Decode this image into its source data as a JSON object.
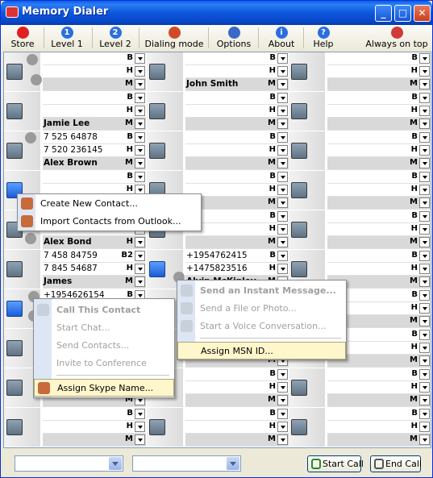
{
  "window": {
    "title": "Memory Dialer",
    "minimize": "_",
    "maximize": "□",
    "close": "✕"
  },
  "toolbar": {
    "items": [
      {
        "label": "Store",
        "icon": "record-icon",
        "color": "#e02020"
      },
      {
        "label": "Level 1",
        "icon": "level-1-icon",
        "color": "#2a6ee0",
        "glyph": "1"
      },
      {
        "label": "Level 2",
        "icon": "level-2-icon",
        "color": "#2a6ee0",
        "glyph": "2"
      },
      {
        "label": "Dialing mode",
        "icon": "phone-icon",
        "color": "#d04a2a"
      },
      {
        "label": "Options",
        "icon": "options-icon",
        "color": "#3a6ac8"
      },
      {
        "label": "About",
        "icon": "info-icon",
        "color": "#2a6ee0",
        "glyph": "i"
      },
      {
        "label": "Help",
        "icon": "help-icon",
        "color": "#2a6ee0",
        "glyph": "?"
      },
      {
        "label": "Always on top",
        "icon": "pin-icon",
        "color": "#d03a3a"
      }
    ]
  },
  "columns": [
    {
      "blocks": [
        {
          "rows": [
            {
              "t": "",
              "k": "B"
            },
            {
              "t": "",
              "k": "H"
            },
            {
              "t": "",
              "k": "M"
            }
          ]
        },
        {
          "rows": [
            {
              "t": "",
              "k": "B"
            },
            {
              "t": "",
              "k": "H"
            },
            {
              "t": "Jamie Lee",
              "k": "M"
            }
          ]
        },
        {
          "rows": [
            {
              "t": "7 525 64878",
              "k": "B"
            },
            {
              "t": "7 520 236145",
              "k": "H"
            },
            {
              "t": "Alex Brown",
              "k": "M"
            }
          ]
        },
        {
          "rows": [
            {
              "t": "",
              "k": "B"
            },
            {
              "t": "",
              "k": "H"
            },
            {
              "t": "",
              "k": "M"
            }
          ]
        },
        {
          "rows": [
            {
              "t": "",
              "k": "B"
            },
            {
              "t": "",
              "k": "H"
            },
            {
              "t": "Alex Bond",
              "k": "H"
            }
          ]
        },
        {
          "rows": [
            {
              "t": "7 458 84759",
              "k": "B2"
            },
            {
              "t": "7 845 54687",
              "k": "H"
            },
            {
              "t": "James",
              "k": "M"
            }
          ]
        },
        {
          "rows": [
            {
              "t": "+1954626154",
              "k": "B"
            },
            {
              "t": "",
              "k": "H"
            },
            {
              "t": "",
              "k": "M"
            }
          ]
        },
        {
          "rows": [
            {
              "t": "",
              "k": "B"
            },
            {
              "t": "",
              "k": "H"
            },
            {
              "t": "",
              "k": "M"
            }
          ]
        },
        {
          "rows": [
            {
              "t": "",
              "k": "B"
            },
            {
              "t": "",
              "k": "H"
            },
            {
              "t": "",
              "k": "M"
            }
          ]
        },
        {
          "rows": [
            {
              "t": "",
              "k": "B"
            },
            {
              "t": "",
              "k": "H"
            },
            {
              "t": "",
              "k": "M"
            }
          ]
        }
      ]
    },
    {
      "blocks": [
        {
          "rows": [
            {
              "t": "",
              "k": "B"
            },
            {
              "t": "",
              "k": "H"
            },
            {
              "t": "John Smith",
              "k": "M"
            }
          ]
        },
        {
          "rows": [
            {
              "t": "",
              "k": "B"
            },
            {
              "t": "",
              "k": "H"
            },
            {
              "t": "",
              "k": "M"
            }
          ]
        },
        {
          "rows": [
            {
              "t": "",
              "k": "B"
            },
            {
              "t": "",
              "k": "H"
            },
            {
              "t": "",
              "k": "M"
            }
          ]
        },
        {
          "rows": [
            {
              "t": "",
              "k": "B"
            },
            {
              "t": "",
              "k": "H"
            },
            {
              "t": "",
              "k": "M"
            }
          ]
        },
        {
          "rows": [
            {
              "t": "",
              "k": "B"
            },
            {
              "t": "",
              "k": "H"
            },
            {
              "t": "",
              "k": "M"
            }
          ]
        },
        {
          "rows": [
            {
              "t": "+1954762415",
              "k": "B"
            },
            {
              "t": "+1475823516",
              "k": "H"
            },
            {
              "t": "Alvin McKinley",
              "k": "M"
            }
          ]
        },
        {
          "rows": [
            {
              "t": "",
              "k": "B"
            },
            {
              "t": "",
              "k": "H"
            },
            {
              "t": "",
              "k": "M"
            }
          ]
        },
        {
          "rows": [
            {
              "t": "",
              "k": "B"
            },
            {
              "t": "",
              "k": "H"
            },
            {
              "t": "",
              "k": "M"
            }
          ]
        },
        {
          "rows": [
            {
              "t": "",
              "k": "B"
            },
            {
              "t": "",
              "k": "H"
            },
            {
              "t": "",
              "k": "M"
            }
          ]
        },
        {
          "rows": [
            {
              "t": "",
              "k": "B"
            },
            {
              "t": "",
              "k": "H"
            },
            {
              "t": "",
              "k": "M"
            }
          ]
        }
      ]
    },
    {
      "blocks": [
        {
          "rows": [
            {
              "t": "",
              "k": "B"
            },
            {
              "t": "",
              "k": "H"
            },
            {
              "t": "",
              "k": "M"
            }
          ]
        },
        {
          "rows": [
            {
              "t": "",
              "k": "B"
            },
            {
              "t": "",
              "k": "H"
            },
            {
              "t": "",
              "k": "M"
            }
          ]
        },
        {
          "rows": [
            {
              "t": "",
              "k": "B"
            },
            {
              "t": "",
              "k": "H"
            },
            {
              "t": "",
              "k": "M"
            }
          ]
        },
        {
          "rows": [
            {
              "t": "",
              "k": "B"
            },
            {
              "t": "",
              "k": "H"
            },
            {
              "t": "",
              "k": "M"
            }
          ]
        },
        {
          "rows": [
            {
              "t": "",
              "k": "B"
            },
            {
              "t": "",
              "k": "H"
            },
            {
              "t": "",
              "k": "M"
            }
          ]
        },
        {
          "rows": [
            {
              "t": "",
              "k": "B"
            },
            {
              "t": "",
              "k": "H"
            },
            {
              "t": "",
              "k": "M"
            }
          ]
        },
        {
          "rows": [
            {
              "t": "",
              "k": "B"
            },
            {
              "t": "",
              "k": "H"
            },
            {
              "t": "",
              "k": "M"
            }
          ]
        },
        {
          "rows": [
            {
              "t": "",
              "k": "B"
            },
            {
              "t": "",
              "k": "H"
            },
            {
              "t": "",
              "k": "M"
            }
          ]
        },
        {
          "rows": [
            {
              "t": "",
              "k": "B"
            },
            {
              "t": "",
              "k": "H"
            },
            {
              "t": "",
              "k": "M"
            }
          ]
        },
        {
          "rows": [
            {
              "t": "",
              "k": "B"
            },
            {
              "t": "",
              "k": "H"
            },
            {
              "t": "",
              "k": "M"
            }
          ]
        }
      ]
    }
  ],
  "menus": {
    "contact": {
      "items": [
        {
          "label": "Create New Contact...",
          "icon": "contact-card-icon"
        },
        {
          "label": "Import Contacts from Outlook...",
          "icon": "clock-icon"
        }
      ]
    },
    "skype": {
      "items": [
        {
          "label": "Call This Contact",
          "bold": true,
          "disabled": true,
          "icon": "skype-call-icon"
        },
        {
          "label": "Start Chat...",
          "disabled": true
        },
        {
          "label": "Send Contacts...",
          "disabled": true
        },
        {
          "label": "Invite to Conference",
          "disabled": true
        },
        {
          "label": "Assign Skype Name...",
          "highlight": true,
          "icon": "skype-assign-icon"
        }
      ]
    },
    "msn": {
      "items": [
        {
          "label": "Send an Instant Message...",
          "bold": true,
          "disabled": true,
          "icon": "msn-message-icon"
        },
        {
          "label": "Send a File or Photo...",
          "disabled": true,
          "icon": "msn-file-icon"
        },
        {
          "label": "Start a Voice Conversation...",
          "disabled": true,
          "icon": "msn-voice-icon"
        },
        {
          "label": "Assign MSN ID...",
          "highlight": true
        }
      ]
    }
  },
  "bottom": {
    "start_call": "Start Call",
    "end_call": "End Call",
    "combo1": "",
    "combo2": ""
  }
}
